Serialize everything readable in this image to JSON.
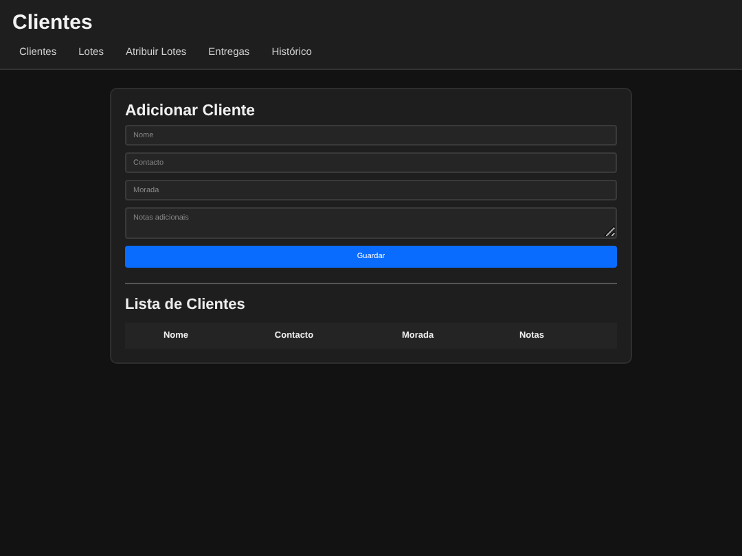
{
  "header": {
    "title": "Clientes",
    "nav": [
      {
        "label": "Clientes"
      },
      {
        "label": "Lotes"
      },
      {
        "label": "Atribuir Lotes"
      },
      {
        "label": "Entregas"
      },
      {
        "label": "Histórico"
      }
    ]
  },
  "form": {
    "title": "Adicionar Cliente",
    "fields": [
      {
        "kind": "input",
        "placeholder": "Nome"
      },
      {
        "kind": "input",
        "placeholder": "Contacto"
      },
      {
        "kind": "input",
        "placeholder": "Morada"
      },
      {
        "kind": "textarea",
        "placeholder": "Notas adicionais"
      }
    ],
    "submit": "Guardar"
  },
  "list": {
    "title": "Lista de Clientes",
    "columns": [
      "Nome",
      "Contacto",
      "Morada",
      "Notas"
    ]
  }
}
